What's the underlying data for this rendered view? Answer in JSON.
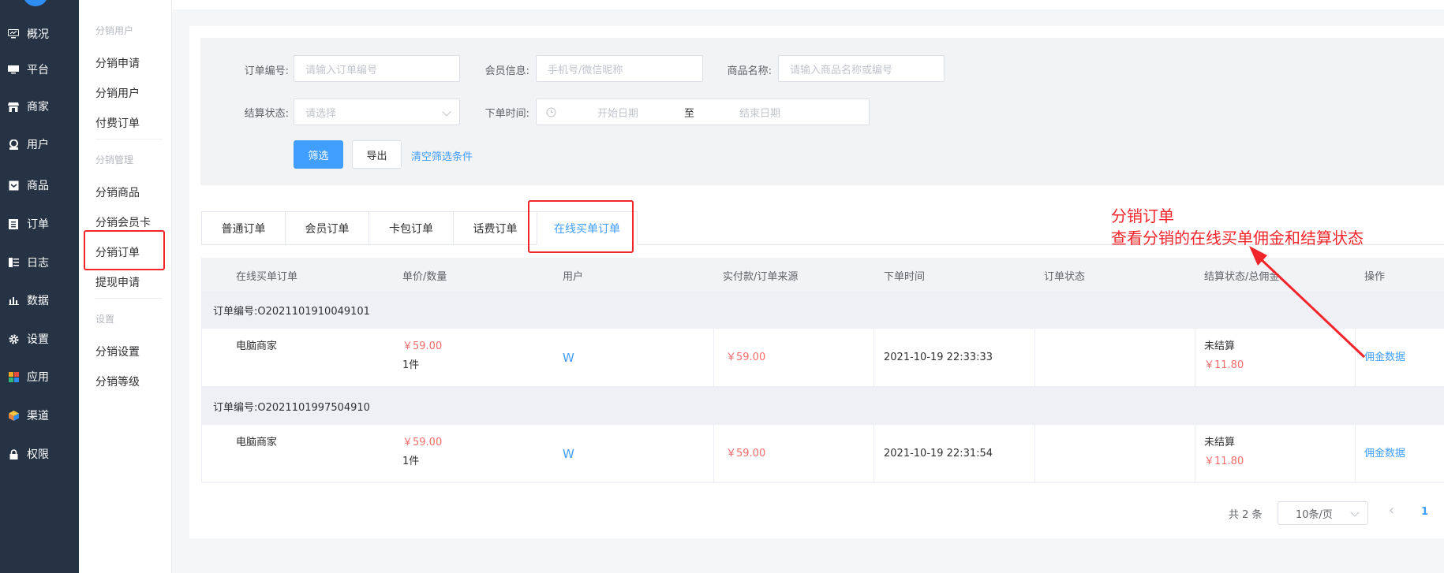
{
  "nav": {
    "items": [
      {
        "icon": "monitor-icon",
        "label": "概况"
      },
      {
        "icon": "desktop-icon",
        "label": "平台"
      },
      {
        "icon": "store-icon",
        "label": "商家"
      },
      {
        "icon": "user-icon",
        "label": "用户"
      },
      {
        "icon": "product-icon",
        "label": "商品"
      },
      {
        "icon": "order-icon",
        "label": "订单"
      },
      {
        "icon": "log-icon",
        "label": "日志"
      },
      {
        "icon": "chart-icon",
        "label": "数据"
      },
      {
        "icon": "gear-icon",
        "label": "设置"
      },
      {
        "icon": "apps-icon",
        "label": "应用"
      },
      {
        "icon": "channel-icon",
        "label": "渠道"
      },
      {
        "icon": "lock-icon",
        "label": "权限"
      }
    ]
  },
  "subnav": {
    "group1": "分销用户",
    "items1": [
      "分销申请",
      "分销用户",
      "付费订单"
    ],
    "group2": "分销管理",
    "items2": [
      "分销商品",
      "分销会员卡",
      "分销订单",
      "提现申请"
    ],
    "group3": "设置",
    "items3": [
      "分销设置",
      "分销等级"
    ]
  },
  "filter": {
    "order_no_label": "订单编号:",
    "order_no_placeholder": "请输入订单编号",
    "member_label": "会员信息:",
    "member_placeholder": "手机号/微信昵称",
    "product_label": "商品名称:",
    "product_placeholder": "请输入商品名称或编号",
    "settle_label": "结算状态:",
    "settle_placeholder": "请选择",
    "time_label": "下单时间:",
    "start_placeholder": "开始日期",
    "range_sep": "至",
    "end_placeholder": "结束日期",
    "filter_button": "筛选",
    "export_button": "导出",
    "clear_link": "清空筛选条件"
  },
  "tabs": [
    "普通订单",
    "会员订单",
    "卡包订单",
    "话费订单",
    "在线买单订单"
  ],
  "active_tab": "在线买单订单",
  "table": {
    "headers": [
      "在线买单订单",
      "单价/数量",
      "用户",
      "实付款/订单来源",
      "下单时间",
      "订单状态",
      "结算状态/总佣金",
      "操作"
    ],
    "groups": [
      {
        "order_no": "订单编号:O2021101910049101",
        "product": "电脑商家",
        "price": "￥59.00",
        "qty": "1件",
        "user": "W",
        "paid": "￥59.00",
        "time": "2021-10-19 22:33:33",
        "status": "",
        "settle": "未结算",
        "commission": "￥11.80",
        "action": "佣金数据"
      },
      {
        "order_no": "订单编号:O2021101997504910",
        "product": "电脑商家",
        "price": "￥59.00",
        "qty": "1件",
        "user": "W",
        "paid": "￥59.00",
        "time": "2021-10-19 22:31:54",
        "status": "",
        "settle": "未结算",
        "commission": "￥11.80",
        "action": "佣金数据"
      }
    ]
  },
  "pagination": {
    "total": "共 2 条",
    "page_size": "10条/页",
    "prev": "‹",
    "current": "1"
  },
  "annotation": {
    "title": "分销订单",
    "desc": "查看分销的在线买单佣金和结算状态"
  },
  "colors": {
    "primary": "#409eff",
    "annotation_red": "#f2252b",
    "nav_bg": "#263345"
  }
}
